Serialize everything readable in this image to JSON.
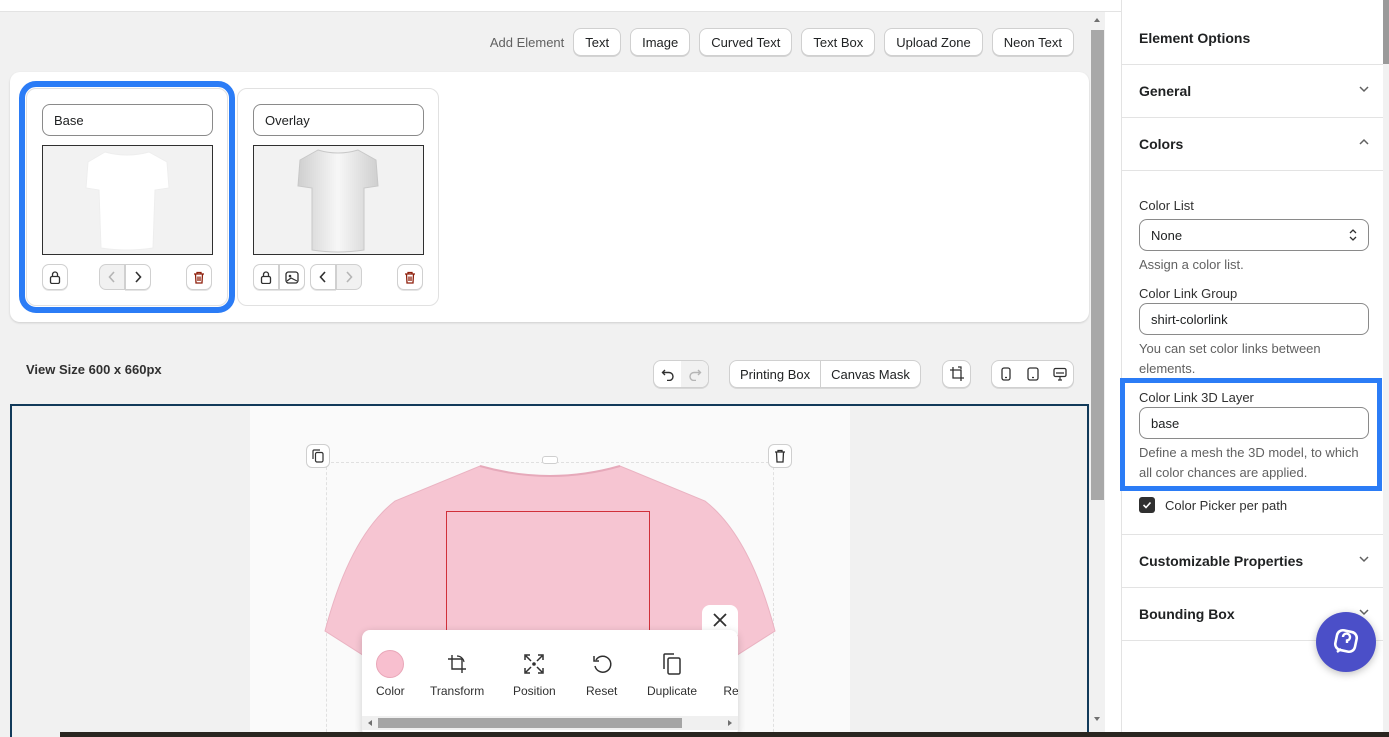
{
  "toolbar": {
    "add_label": "Add Element",
    "buttons": [
      "Text",
      "Image",
      "Curved Text",
      "Text Box",
      "Upload Zone",
      "Neon Text"
    ]
  },
  "layers": [
    {
      "name": "Base",
      "selected": true
    },
    {
      "name": "Overlay",
      "selected": false
    }
  ],
  "view": {
    "size_label": "View Size 600 x 660px",
    "printing_box": "Printing Box",
    "canvas_mask": "Canvas Mask"
  },
  "element_toolbar": {
    "color_label": "Color",
    "transform_label": "Transform",
    "position_label": "Position",
    "reset_label": "Reset",
    "duplicate_label": "Duplicate",
    "remove_label": "Re",
    "swatch_color": "#f8bfcf"
  },
  "shirt_color": "#f6c5d2",
  "panel": {
    "title": "Element Options",
    "general": "General",
    "colors": "Colors",
    "color_list_label": "Color List",
    "color_list_value": "None",
    "color_list_help": "Assign a color list.",
    "color_link_group_label": "Color Link Group",
    "color_link_group_value": "shirt-colorlink",
    "color_link_group_help": "You can set color links between elements.",
    "color_link_3d_label": "Color Link 3D Layer",
    "color_link_3d_value": "base",
    "color_link_3d_help": "Define a mesh the 3D model, to which all color chances are applied.",
    "color_picker_label": "Color Picker per path",
    "customizable": "Customizable Properties",
    "bounding_box": "Bounding Box"
  },
  "accent": "#2b7cf6"
}
